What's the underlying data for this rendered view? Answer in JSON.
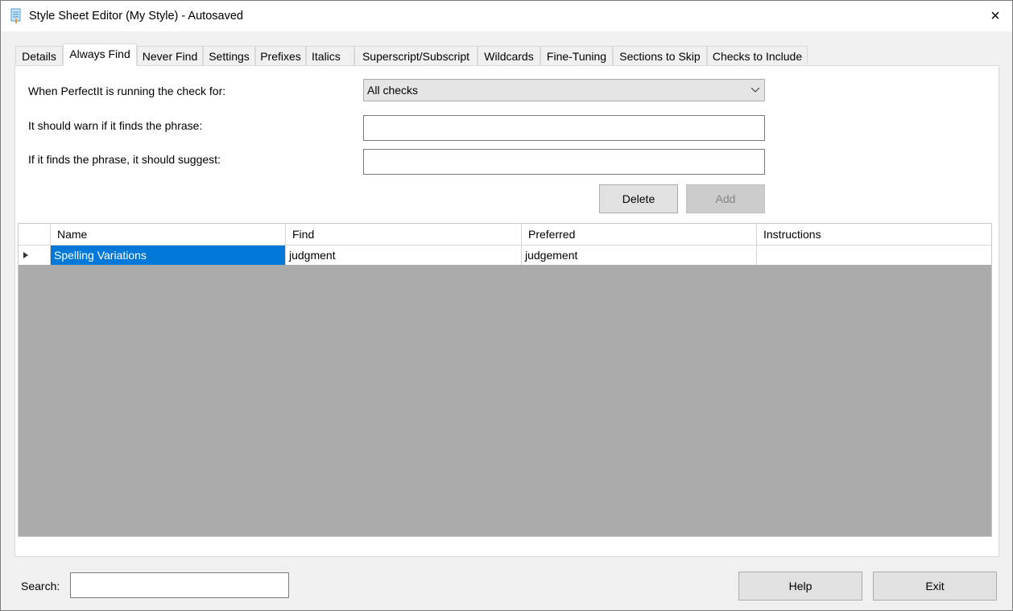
{
  "window": {
    "title": "Style Sheet Editor (My Style) - Autosaved",
    "close_icon": "×"
  },
  "tabs": [
    {
      "label": "Details"
    },
    {
      "label": "Always Find",
      "selected": true
    },
    {
      "label": "Never Find"
    },
    {
      "label": "Settings"
    },
    {
      "label": "Prefixes"
    },
    {
      "label": "Italics"
    },
    {
      "label": "Superscript/Subscript"
    },
    {
      "label": "Wildcards"
    },
    {
      "label": "Fine-Tuning"
    },
    {
      "label": "Sections to Skip"
    },
    {
      "label": "Checks to Include"
    }
  ],
  "form": {
    "check_label": "When PerfectIt is running the check for:",
    "check_value": "All checks",
    "warn_label": "It should warn if it finds the phrase:",
    "warn_value": "",
    "suggest_label": "If it finds the phrase, it should suggest:",
    "suggest_value": "",
    "delete_label": "Delete",
    "add_label": "Add"
  },
  "grid": {
    "columns": [
      "Name",
      "Find",
      "Preferred",
      "Instructions"
    ],
    "rows": [
      {
        "name": "Spelling Variations",
        "find": "judgment",
        "preferred": "judgement",
        "instructions": ""
      }
    ]
  },
  "footer": {
    "search_label": "Search:",
    "search_value": "",
    "help_label": "Help",
    "exit_label": "Exit"
  },
  "colors": {
    "selection": "#0078d7",
    "grid_bg": "#ababab"
  }
}
